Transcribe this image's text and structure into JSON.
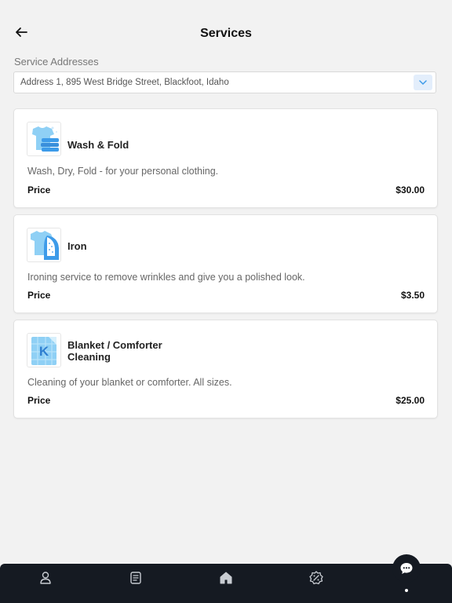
{
  "header": {
    "title": "Services"
  },
  "address": {
    "label": "Service Addresses",
    "selected": "Address 1, 895 West Bridge Street, Blackfoot, Idaho"
  },
  "services": [
    {
      "title": "Wash & Fold",
      "description": "Wash, Dry, Fold - for your personal clothing.",
      "price_label": "Price",
      "price": "$30.00",
      "icon": "wash-fold-icon"
    },
    {
      "title": "Iron",
      "description": "Ironing service to remove wrinkles and give you a polished look.",
      "price_label": "Price",
      "price": "$3.50",
      "icon": "iron-shirt-icon"
    },
    {
      "title_line1": "Blanket / Comforter",
      "title_line2": "Cleaning",
      "description": "Cleaning of your blanket or comforter. All sizes.",
      "price_label": "Price",
      "price": "$25.00",
      "icon": "blanket-icon",
      "icon_letter": "K"
    }
  ],
  "tabbar": {
    "tabs": [
      {
        "icon": "profile-icon"
      },
      {
        "icon": "orders-icon"
      },
      {
        "icon": "home-icon"
      },
      {
        "icon": "discount-icon"
      }
    ]
  },
  "colors": {
    "accent_blue": "#3d9be9",
    "light_blue": "#8fd0f5",
    "tabbar_bg": "#151a22"
  }
}
